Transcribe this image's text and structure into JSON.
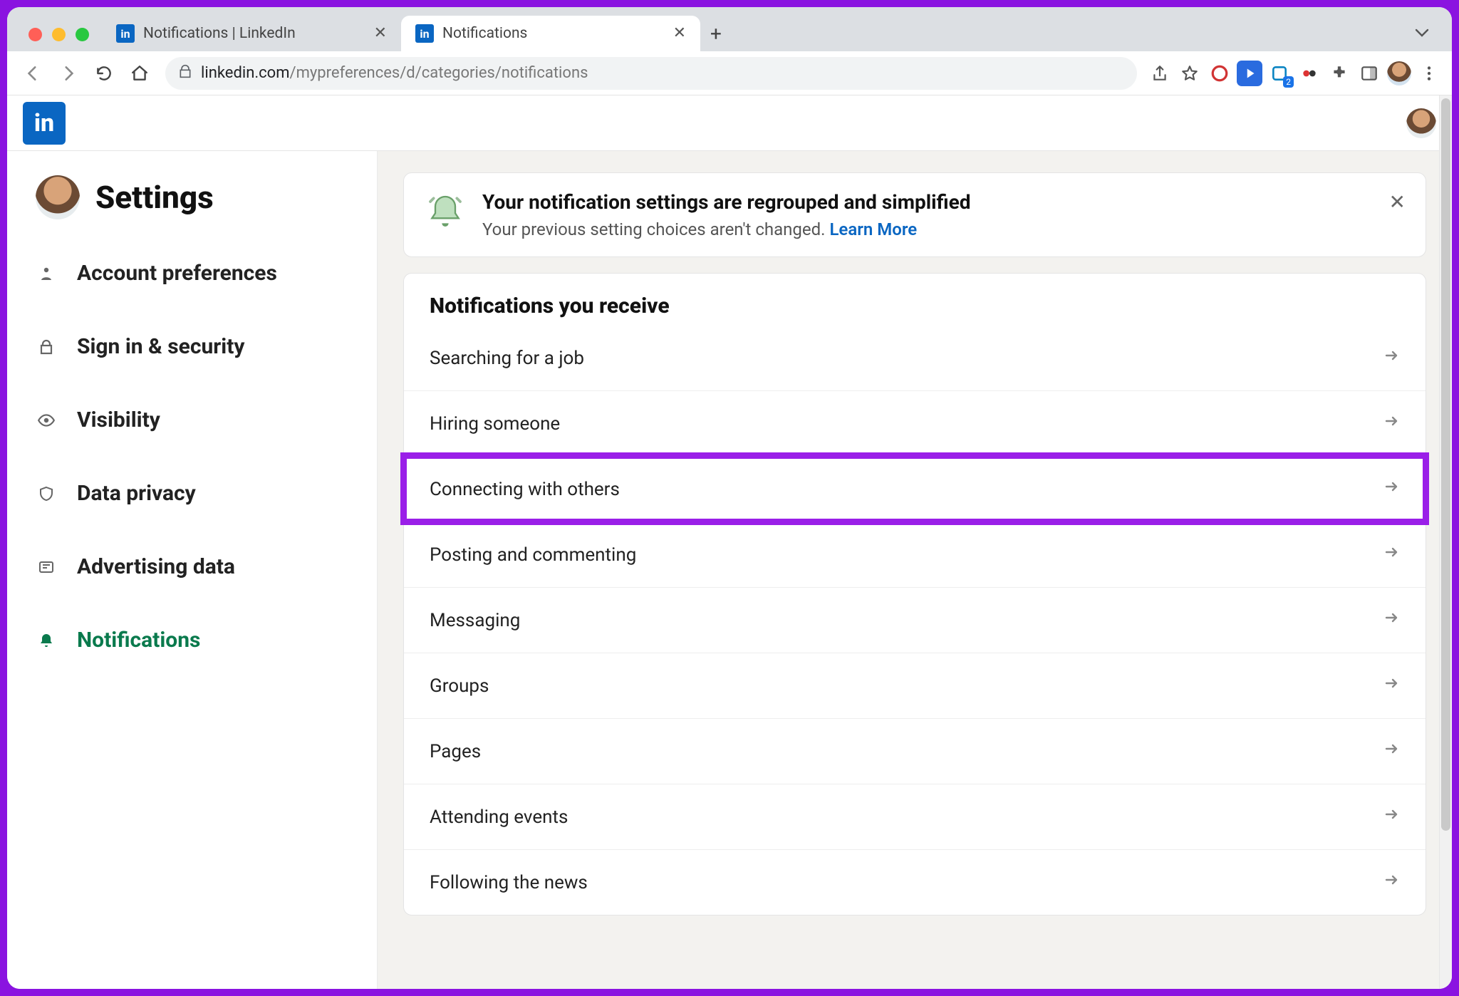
{
  "browser": {
    "tabs": [
      {
        "title": "Notifications | LinkedIn",
        "active": false
      },
      {
        "title": "Notifications",
        "active": true
      }
    ],
    "url_host": "linkedin.com",
    "url_path": "/mypreferences/d/categories/notifications"
  },
  "header": {
    "logo_text": "in"
  },
  "sidebar": {
    "title": "Settings",
    "items": [
      {
        "label": "Account preferences",
        "icon": "person"
      },
      {
        "label": "Sign in & security",
        "icon": "lock"
      },
      {
        "label": "Visibility",
        "icon": "eye"
      },
      {
        "label": "Data privacy",
        "icon": "shield"
      },
      {
        "label": "Advertising data",
        "icon": "newspaper"
      },
      {
        "label": "Notifications",
        "icon": "bell",
        "active": true,
        "highlighted": true
      }
    ]
  },
  "banner": {
    "title": "Your notification settings are regrouped and simplified",
    "body": "Your previous setting choices aren't changed. ",
    "link": "Learn More"
  },
  "notifications": {
    "heading": "Notifications you receive",
    "rows": [
      {
        "label": "Searching for a job"
      },
      {
        "label": "Hiring someone"
      },
      {
        "label": "Connecting with others",
        "highlighted": true
      },
      {
        "label": "Posting and commenting"
      },
      {
        "label": "Messaging"
      },
      {
        "label": "Groups"
      },
      {
        "label": "Pages"
      },
      {
        "label": "Attending events"
      },
      {
        "label": "Following the news"
      }
    ]
  }
}
